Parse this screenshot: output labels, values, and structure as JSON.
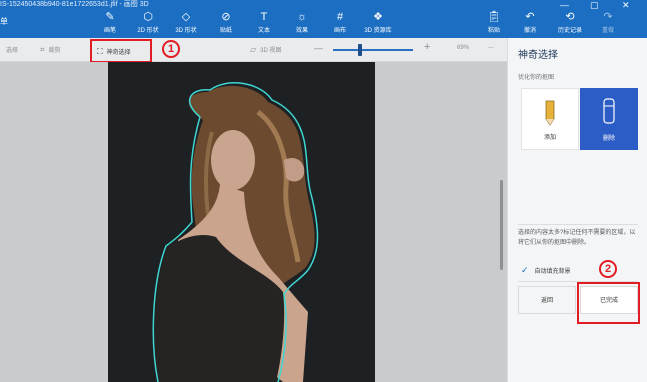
{
  "window": {
    "title": "IS-152450438b940-81e1722653d1.jfif - 画图 3D",
    "left_edge_label": "单"
  },
  "ribbon": {
    "tools": [
      {
        "label": "画笔",
        "icon": "brush-icon"
      },
      {
        "label": "2D 形状",
        "icon": "shapes-2d-icon"
      },
      {
        "label": "3D 形状",
        "icon": "cube-icon"
      },
      {
        "label": "贴纸",
        "icon": "sticker-icon"
      },
      {
        "label": "文本",
        "icon": "text-icon"
      },
      {
        "label": "效果",
        "icon": "sun-effects-icon"
      },
      {
        "label": "画布",
        "icon": "canvas-icon"
      },
      {
        "label": "3D 资源库",
        "icon": "library-icon"
      }
    ],
    "right_tools": [
      {
        "label": "粘贴",
        "icon": "paste-icon"
      },
      {
        "label": "撤消",
        "icon": "undo-icon"
      },
      {
        "label": "历史记录",
        "icon": "history-icon"
      },
      {
        "label": "重做",
        "icon": "redo-icon"
      }
    ],
    "window_controls": [
      "—",
      "▢",
      "✕"
    ]
  },
  "subbar": {
    "select_label": "选择",
    "crop_label": "裁剪",
    "magic_select_label": "神奇选择",
    "view3d_label": "3D 视图",
    "zoom_minus": "—",
    "zoom_plus": "+",
    "zoom_value": "69%",
    "more": "···"
  },
  "annotations": {
    "num1": "1",
    "num2": "2",
    "color": "#e21c24"
  },
  "panel": {
    "title": "神奇选择",
    "subtitle": "优化你的抠图",
    "add_label": "添加",
    "remove_label": "删除",
    "description": "选择的内容太多?标记任何不需要的区域，以将它们从你的抠图中删除。",
    "autofill_label": "自动填充背景",
    "back_label": "返回",
    "done_label": "已完成"
  },
  "colors": {
    "ribbon": "#1b6ec2",
    "accent": "#2c5cc5",
    "selection_outline": "#3fd6d2"
  }
}
